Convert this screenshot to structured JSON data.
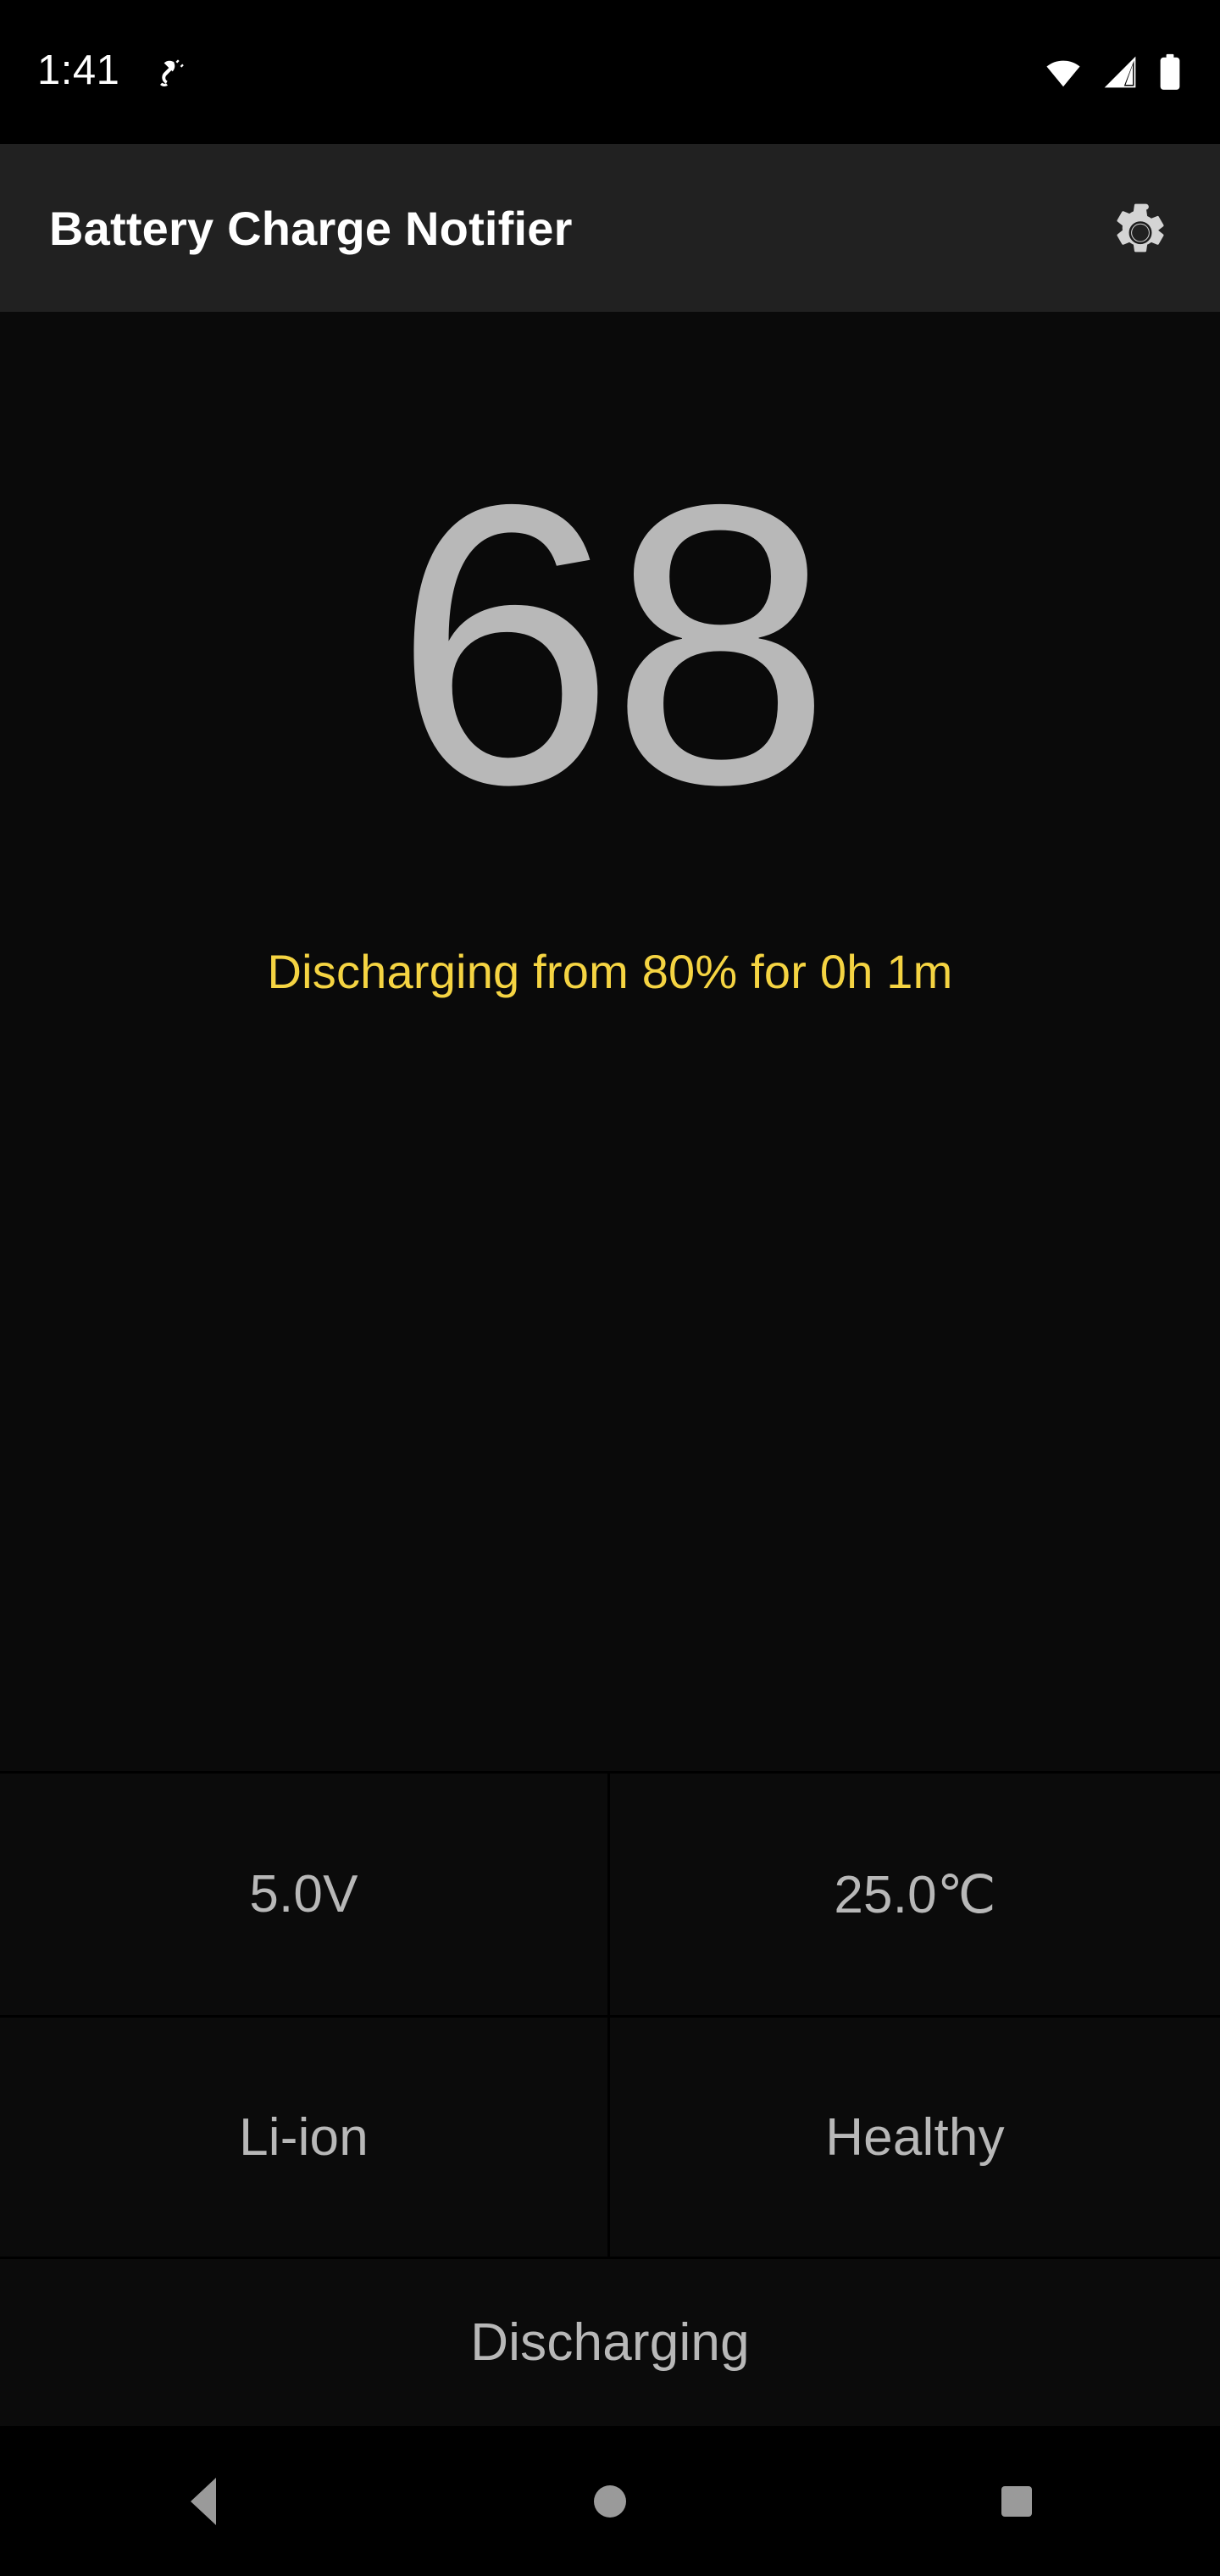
{
  "status_bar": {
    "clock": "1:41",
    "icons": {
      "plug": "power-plug-icon",
      "wifi": "wifi-full-icon",
      "signal": "cellular-signal-icon",
      "battery": "battery-icon"
    }
  },
  "app_bar": {
    "title": "Battery Charge Notifier",
    "settings_icon": "gear-icon"
  },
  "battery": {
    "level": "68",
    "status_line": "Discharging from 80% for 0h 1m",
    "voltage": "5.0V",
    "temperature": "25.0℃",
    "technology": "Li-ion",
    "health": "Healthy",
    "charging_state": "Discharging"
  },
  "colors": {
    "background": "#0a0a0a",
    "app_bar": "#212121",
    "status_bar": "#000000",
    "level_text": "#b8b8b8",
    "status_accent": "#f5d442",
    "cell_text": "#b8b8b8",
    "nav_icon": "#9a9a9a"
  },
  "nav_bar": {
    "back": "back-nav-icon",
    "home": "home-nav-icon",
    "recents": "recents-nav-icon"
  }
}
